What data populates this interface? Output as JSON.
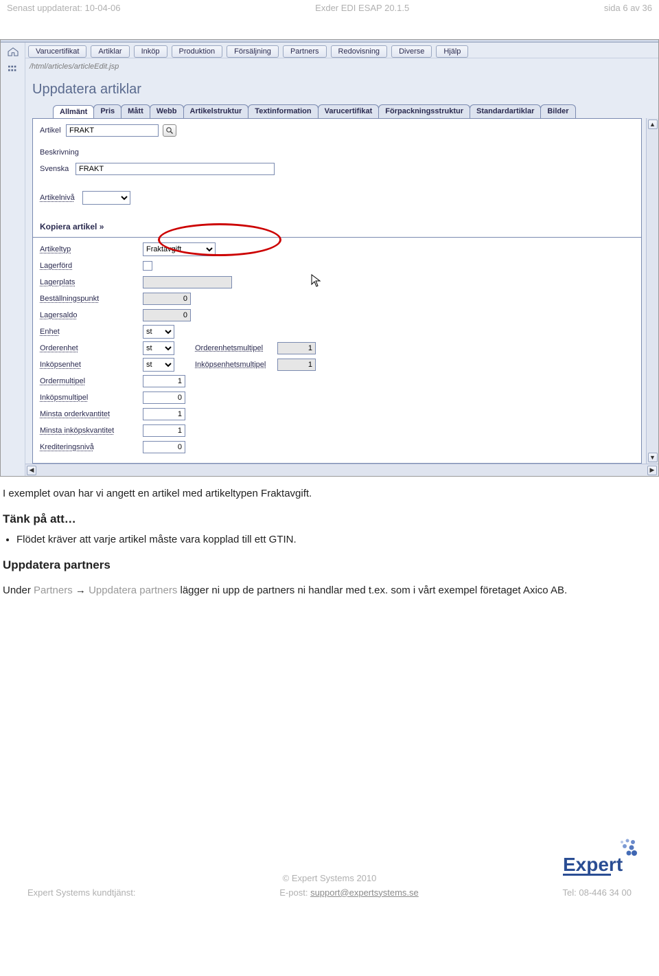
{
  "header": {
    "left": "Senast uppdaterat: 10-04-06",
    "center": "Exder EDI ESAP 20.1.5",
    "right": "sida 6 av 36"
  },
  "app": {
    "url": "/html/articles/articleEdit.jsp",
    "title": "Uppdatera artiklar",
    "menu": [
      "Varucertifikat",
      "Artiklar",
      "Inköp",
      "Produktion",
      "Försäljning",
      "Partners",
      "Redovisning",
      "Diverse",
      "Hjälp"
    ],
    "tabs": [
      "Allmänt",
      "Pris",
      "Mått",
      "Webb",
      "Artikelstruktur",
      "Textinformation",
      "Varucertifikat",
      "Förpackningsstruktur",
      "Standardartiklar",
      "Bilder"
    ],
    "active_tab": 0,
    "form": {
      "artikel_label": "Artikel",
      "artikel_value": "FRAKT",
      "beskrivning_label": "Beskrivning",
      "svenska_label": "Svenska",
      "svenska_value": "FRAKT",
      "artikelniva_label": "Artikelnivå",
      "artikelniva_value": "",
      "copy_link": "Kopiera artikel »",
      "artikeltyp_label": "Artikeltyp",
      "artikeltyp_value": "Fraktavgift",
      "lagerford_label": "Lagerförd",
      "lagerplats_label": "Lagerplats",
      "lagerplats_value": "",
      "bestallningspunkt_label": "Beställningspunkt",
      "bestallningspunkt_value": "0",
      "lagersaldo_label": "Lagersaldo",
      "lagersaldo_value": "0",
      "enhet_label": "Enhet",
      "enhet_value": "st",
      "orderenhet_label": "Orderenhet",
      "orderenhet_value": "st",
      "orderenhetsmultipel_label": "Orderenhetsmultipel",
      "orderenhetsmultipel_value": "1",
      "inkopsenhet_label": "Inköpsenhet",
      "inkopsenhet_value": "st",
      "inkopsenhetsmultipel_label": "Inköpsenhetsmultipel",
      "inkopsenhetsmultipel_value": "1",
      "ordermultipel_label": "Ordermultipel",
      "ordermultipel_value": "1",
      "inkopsmultipel_label": "Inköpsmultipel",
      "inkopsmultipel_value": "0",
      "minsta_orderkv_label": "Minsta orderkvantitet",
      "minsta_orderkv_value": "1",
      "minsta_inkopskv_label": "Minsta inköpskvantitet",
      "minsta_inkopskv_value": "1",
      "krediteringsniva_label": "Krediteringsnivå",
      "krediteringsniva_value": "0"
    }
  },
  "body": {
    "p1": "I exemplet ovan har vi angett en artikel med artikeltypen Fraktavgift.",
    "h1": "Tänk på att…",
    "li1": "Flödet kräver att varje artikel måste vara kopplad till ett GTIN.",
    "h2": "Uppdatera partners",
    "p2_prefix": "Under ",
    "p2_nav1": "Partners",
    "p2_arrow": " → ",
    "p2_nav2": "Uppdatera partners",
    "p2_mid": " lägger ni upp de partners ni handlar med t.ex. som i vårt exempel företaget Axico AB."
  },
  "footer": {
    "copyright": "© Expert Systems 2010",
    "left": "Expert Systems kundtjänst:",
    "center_prefix": "E-post: ",
    "center_link": "support@expertsystems.se",
    "right": "Tel: 08-446 34 00",
    "logo_text": "Expert"
  }
}
